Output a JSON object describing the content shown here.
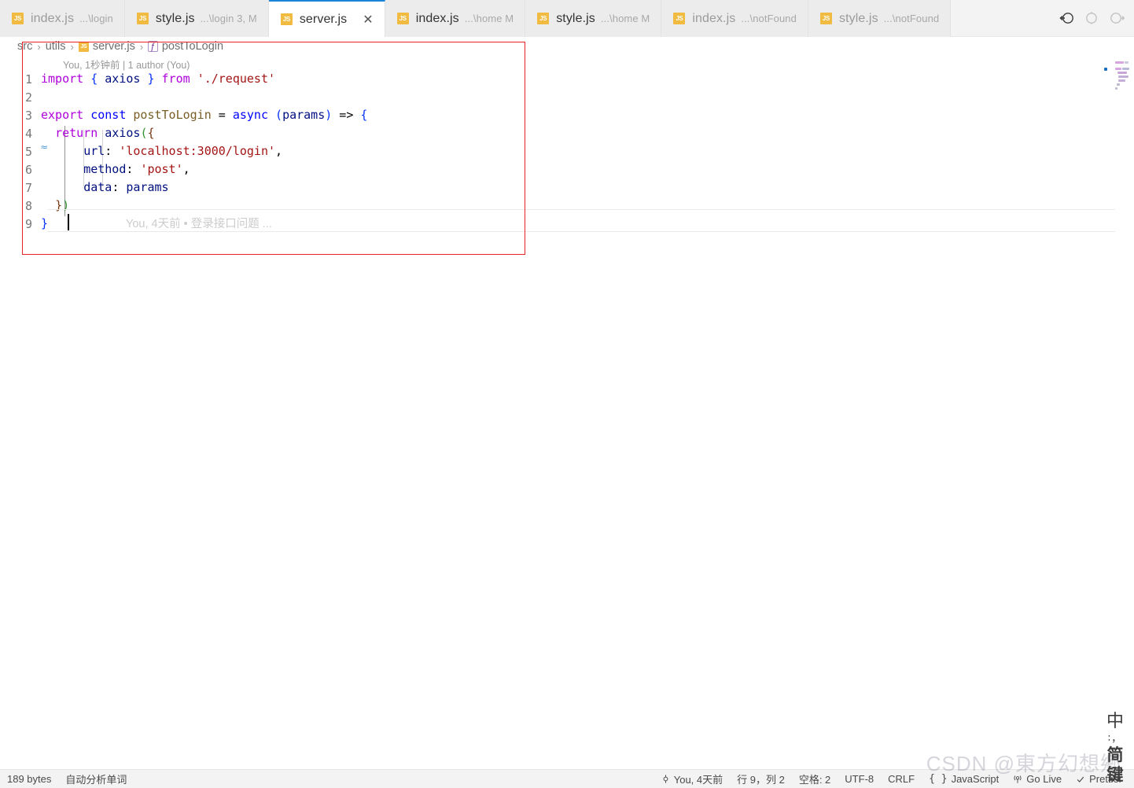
{
  "tabs": [
    {
      "icon": "js-file-icon",
      "name": "index.js",
      "desc": "...\\login",
      "active": false,
      "modified": false,
      "close": ""
    },
    {
      "icon": "js-file-icon",
      "name": "style.js",
      "desc": "...\\login 3, M",
      "active": false,
      "modified": true,
      "close": ""
    },
    {
      "icon": "js-file-icon",
      "name": "server.js",
      "desc": "",
      "active": true,
      "modified": false,
      "close": "✕"
    },
    {
      "icon": "js-file-icon",
      "name": "index.js",
      "desc": "...\\home M",
      "active": false,
      "modified": true,
      "close": ""
    },
    {
      "icon": "js-file-icon",
      "name": "style.js",
      "desc": "...\\home M",
      "active": false,
      "modified": true,
      "close": ""
    },
    {
      "icon": "js-file-icon",
      "name": "index.js",
      "desc": "...\\notFound",
      "active": false,
      "modified": false,
      "close": ""
    },
    {
      "icon": "js-file-icon",
      "name": "style.js",
      "desc": "...\\notFound",
      "active": false,
      "modified": false,
      "close": ""
    }
  ],
  "tab_icon_label": "JS",
  "tab_actions": [
    {
      "name": "split-editor-left-icon"
    },
    {
      "name": "split-editor-icon"
    },
    {
      "name": "more-actions-icon"
    }
  ],
  "breadcrumb": {
    "items": [
      {
        "label": "src",
        "type": "folder"
      },
      {
        "label": "utils",
        "type": "folder"
      },
      {
        "label": "server.js",
        "type": "js-file"
      },
      {
        "label": "postToLogin",
        "type": "symbol-function"
      }
    ],
    "separator": "›",
    "symbol_glyph": "ƒ"
  },
  "editor": {
    "blame_header": "You, 1秒钟前 | 1 author (You)",
    "inline_blame": "You, 4天前  •  登录接口问题  ...",
    "lines": [
      {
        "n": "1",
        "text": "import { axios } from './request'"
      },
      {
        "n": "2",
        "text": ""
      },
      {
        "n": "3",
        "text": "export const postToLogin = async (params) => {"
      },
      {
        "n": "4",
        "text": "  return axios({"
      },
      {
        "n": "5",
        "text": "      url: 'localhost:3000/login',"
      },
      {
        "n": "6",
        "text": "      method: 'post',"
      },
      {
        "n": "7",
        "text": "      data: params"
      },
      {
        "n": "8",
        "text": "  })"
      },
      {
        "n": "9",
        "text": "}"
      }
    ],
    "tokens": {
      "l1": [
        {
          "t": "import",
          "c": "tok-kw"
        },
        {
          "t": " ",
          "c": "tok-punc"
        },
        {
          "t": "{",
          "c": "tok-br1"
        },
        {
          "t": " ",
          "c": "tok-punc"
        },
        {
          "t": "axios",
          "c": "tok-var"
        },
        {
          "t": " ",
          "c": "tok-punc"
        },
        {
          "t": "}",
          "c": "tok-br1"
        },
        {
          "t": " ",
          "c": "tok-punc"
        },
        {
          "t": "from",
          "c": "tok-kw"
        },
        {
          "t": " ",
          "c": "tok-punc"
        },
        {
          "t": "'./request'",
          "c": "tok-str"
        }
      ],
      "l3": [
        {
          "t": "export",
          "c": "tok-kw"
        },
        {
          "t": " ",
          "c": "tok-punc"
        },
        {
          "t": "const",
          "c": "tok-decl"
        },
        {
          "t": " ",
          "c": "tok-punc"
        },
        {
          "t": "postToLogin",
          "c": "tok-fn"
        },
        {
          "t": " = ",
          "c": "tok-op"
        },
        {
          "t": "async",
          "c": "tok-decl"
        },
        {
          "t": " ",
          "c": "tok-punc"
        },
        {
          "t": "(",
          "c": "tok-br1"
        },
        {
          "t": "params",
          "c": "tok-var"
        },
        {
          "t": ")",
          "c": "tok-br1"
        },
        {
          "t": " => ",
          "c": "tok-op"
        },
        {
          "t": "{",
          "c": "tok-br1"
        }
      ],
      "l4": [
        {
          "t": "  ",
          "c": "tok-punc"
        },
        {
          "t": "return",
          "c": "tok-kw"
        },
        {
          "t": " ",
          "c": "tok-punc"
        },
        {
          "t": "axios",
          "c": "tok-var"
        },
        {
          "t": "(",
          "c": "tok-br2"
        },
        {
          "t": "{",
          "c": "tok-br3"
        }
      ],
      "l5": [
        {
          "t": "      ",
          "c": "tok-punc"
        },
        {
          "t": "url",
          "c": "tok-var"
        },
        {
          "t": ": ",
          "c": "tok-punc"
        },
        {
          "t": "'localhost:3000/login'",
          "c": "tok-str"
        },
        {
          "t": ",",
          "c": "tok-punc"
        }
      ],
      "l6": [
        {
          "t": "      ",
          "c": "tok-punc"
        },
        {
          "t": "method",
          "c": "tok-var"
        },
        {
          "t": ": ",
          "c": "tok-punc"
        },
        {
          "t": "'post'",
          "c": "tok-str"
        },
        {
          "t": ",",
          "c": "tok-punc"
        }
      ],
      "l7": [
        {
          "t": "      ",
          "c": "tok-punc"
        },
        {
          "t": "data",
          "c": "tok-var"
        },
        {
          "t": ": ",
          "c": "tok-punc"
        },
        {
          "t": "params",
          "c": "tok-var"
        }
      ],
      "l8": [
        {
          "t": "  ",
          "c": "tok-punc"
        },
        {
          "t": "}",
          "c": "tok-br3"
        },
        {
          "t": ")",
          "c": "tok-br2"
        }
      ],
      "l9": [
        {
          "t": "}",
          "c": "tok-br1"
        }
      ]
    }
  },
  "statusbar": {
    "left": [
      {
        "name": "file-size",
        "label": "189 bytes"
      },
      {
        "name": "word-analysis",
        "label": "自动分析单词"
      }
    ],
    "right": [
      {
        "name": "git-blame",
        "label": "You, 4天前",
        "icon": "git-commit-icon"
      },
      {
        "name": "cursor-position",
        "label": "行 9，列 2"
      },
      {
        "name": "indentation",
        "label": "空格: 2"
      },
      {
        "name": "encoding",
        "label": "UTF-8"
      },
      {
        "name": "line-endings",
        "label": "CRLF"
      },
      {
        "name": "language-mode",
        "label": "JavaScript",
        "icon": "braces-icon"
      },
      {
        "name": "go-live",
        "label": "Go Live",
        "icon": "broadcast-icon"
      },
      {
        "name": "prettier",
        "label": "Prettier",
        "icon": "check-icon"
      }
    ]
  },
  "watermark": {
    "text": "CSDN @東方幻想鄉"
  },
  "ime": {
    "buttons": [
      {
        "name": "ime-language-toggle",
        "glyph": "中"
      },
      {
        "name": "ime-punctuation-toggle",
        "glyph": "∶，"
      },
      {
        "name": "ime-simplified-toggle",
        "glyph": "简"
      },
      {
        "name": "ime-keyboard-toggle",
        "glyph": "键"
      }
    ]
  },
  "colors": {
    "accent": "#1a85d6",
    "annotation": "#ee2222",
    "tab_bg": "#ececec",
    "active_tab_bg": "#ffffff",
    "statusbar_bg": "#f3f3f3",
    "js_icon": "#f0bb40"
  },
  "annotation_box": {
    "name": "red-highlight-rectangle"
  }
}
